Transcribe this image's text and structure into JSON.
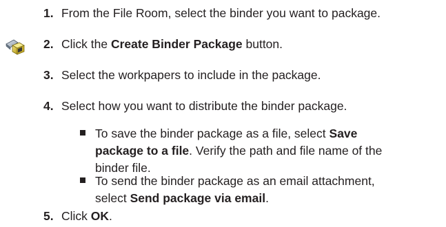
{
  "steps": [
    {
      "num": "1.",
      "text": "From the File Room, select the binder you want to package."
    },
    {
      "num": "2.",
      "pre": "Click the ",
      "bold": "Create Binder Package",
      "post": " button."
    },
    {
      "num": "3.",
      "text": "Select the workpapers to include in the package."
    },
    {
      "num": "4.",
      "text": "Select how you want to distribute the binder package."
    },
    {
      "num": "5.",
      "pre": "Click ",
      "bold": "OK",
      "post": "."
    }
  ],
  "bullets": [
    {
      "l1_pre": "To save the binder package as a file, select ",
      "l1_bold": "Save",
      "l2_bold": "package to a file",
      "l2_post": ". Verify the path and file name of the",
      "l3": "binder file."
    },
    {
      "l1": "To send the binder package as an email attachment,",
      "l2_pre": "select ",
      "l2_bold": "Send package via email",
      "l2_post": "."
    }
  ],
  "icon": "create-binder-package-icon"
}
